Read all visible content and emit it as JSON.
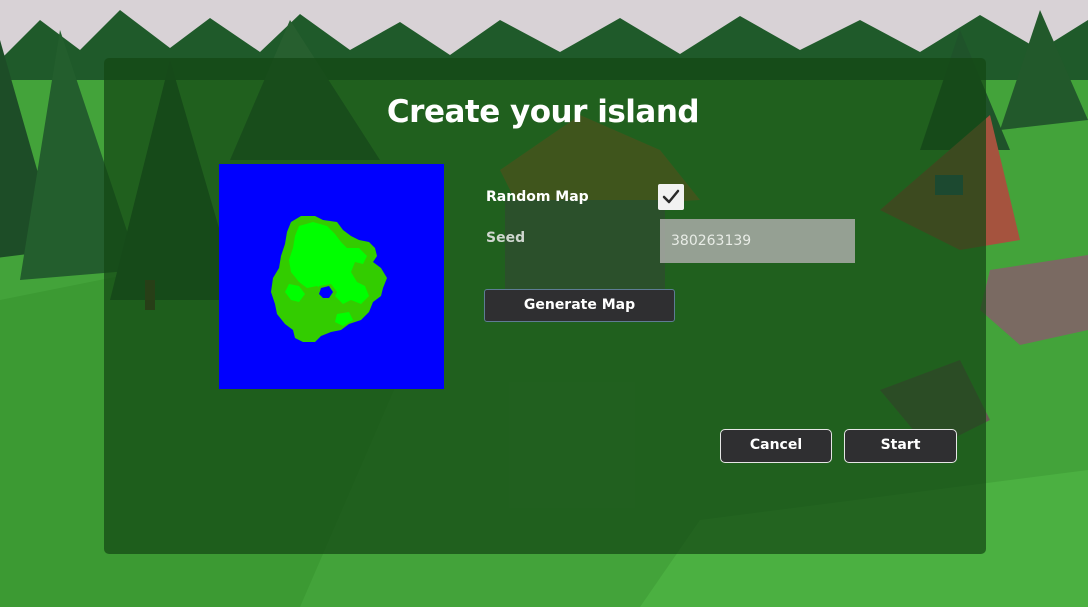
{
  "dialog": {
    "title": "Create your island"
  },
  "map_preview": {
    "icon": "island-map-preview",
    "water_color": "#0000ff",
    "land_color": "#33cc00",
    "highland_color": "#00ff00"
  },
  "options": {
    "random_map_label": "Random Map",
    "random_map_checked": true,
    "seed_label": "Seed",
    "seed_value": "380263139"
  },
  "buttons": {
    "generate_label": "Generate Map",
    "cancel_label": "Cancel",
    "start_label": "Start"
  }
}
